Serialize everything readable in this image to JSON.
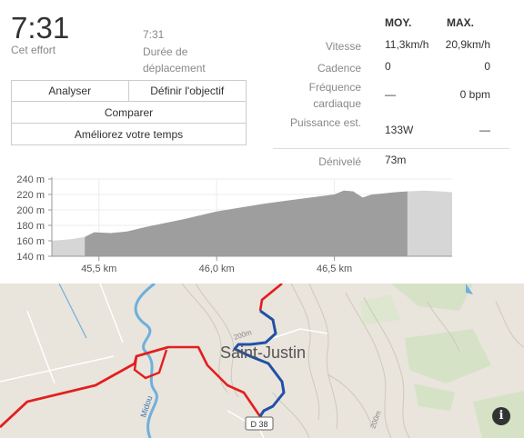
{
  "summary": {
    "effort_time": "7:31",
    "effort_label": "Cet effort",
    "moving_time": "7:31",
    "moving_label": "Durée de déplacement"
  },
  "buttons": {
    "analyze": "Analyser",
    "set_goal": "Définir l'objectif",
    "compare": "Comparer",
    "improve": "Améliorez votre temps"
  },
  "stats": {
    "header_avg": "MOY.",
    "header_max": "MAX.",
    "rows": [
      {
        "label": "Vitesse",
        "avg": "11,3km/h",
        "max": "20,9km/h"
      },
      {
        "label": "Cadence",
        "avg": "0",
        "max": "0"
      },
      {
        "label": "Fréquence cardiaque",
        "avg": "—",
        "max": "0 bpm"
      },
      {
        "label": "Puissance est.",
        "avg": "133W",
        "max": "—"
      },
      {
        "label": "Dénivelé",
        "avg": "73m",
        "max": ""
      }
    ]
  },
  "chart_data": {
    "type": "area",
    "y_ticks": [
      "240 m",
      "220 m",
      "200 m",
      "180 m",
      "160 m",
      "140 m"
    ],
    "ylim": [
      140,
      240
    ],
    "x_ticks": [
      {
        "label": "45,5 km",
        "value": 45.5
      },
      {
        "label": "46,0 km",
        "value": 46.0
      },
      {
        "label": "46,5 km",
        "value": 46.5
      }
    ],
    "xlim": [
      45.3,
      47.0
    ],
    "segment_start_km": 45.44,
    "segment_end_km": 46.81,
    "x": [
      45.3,
      45.38,
      45.44,
      45.48,
      45.55,
      45.62,
      45.7,
      45.78,
      45.86,
      46.0,
      46.1,
      46.2,
      46.3,
      46.4,
      46.5,
      46.54,
      46.58,
      46.62,
      46.66,
      46.7,
      46.76,
      46.81,
      46.88,
      46.95,
      47.0
    ],
    "y": [
      160,
      162,
      165,
      171,
      170,
      172,
      178,
      183,
      188,
      198,
      203,
      208,
      212,
      216,
      220,
      225,
      224,
      216,
      220,
      221,
      223,
      224,
      225,
      224,
      223
    ],
    "grid": true
  },
  "map": {
    "place_name": "Saint-Justin",
    "road_label": "D 38",
    "river_label": "Midou",
    "contour_labels": [
      "200m",
      "200m"
    ],
    "info_symbol": "i",
    "route_color": "#e31e1e",
    "segment_color": "#2150a8"
  }
}
